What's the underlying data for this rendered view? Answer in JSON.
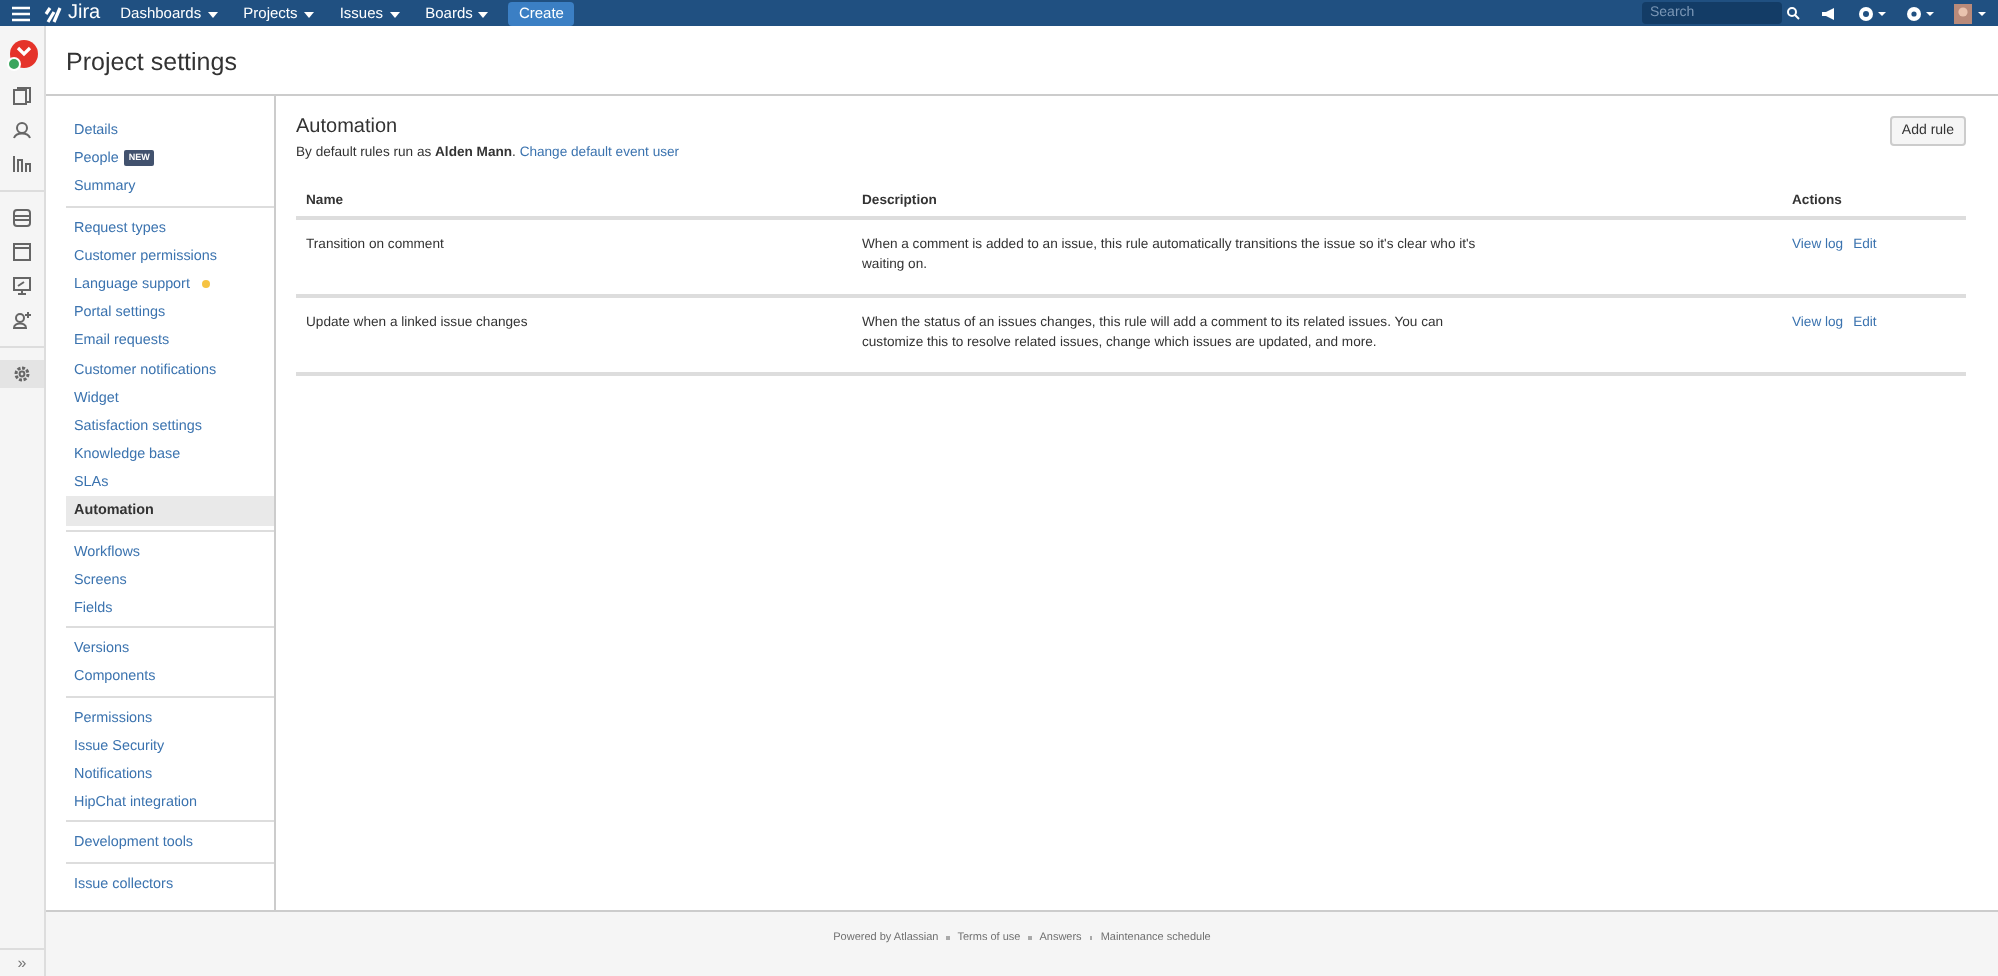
{
  "topbar": {
    "logo": "Jira",
    "menus": [
      {
        "label": "Dashboards"
      },
      {
        "label": "Projects"
      },
      {
        "label": "Issues"
      },
      {
        "label": "Boards"
      }
    ],
    "create": "Create",
    "search": {
      "placeholder": "Search"
    }
  },
  "rail": {
    "icons": [
      {
        "kind": "pages",
        "selected": false
      },
      {
        "kind": "team",
        "selected": false
      },
      {
        "kind": "chart",
        "selected": false
      },
      {
        "kind": "queue",
        "selected": false
      },
      {
        "kind": "window",
        "selected": false
      },
      {
        "kind": "screen",
        "selected": false
      },
      {
        "kind": "adduser",
        "selected": false
      },
      {
        "kind": "gear",
        "selected": true
      }
    ],
    "expand": "»"
  },
  "page_title": "Project settings",
  "sidebar": {
    "groups": [
      [
        {
          "label": "Details",
          "selected": false
        },
        {
          "label": "People",
          "badge": "NEW",
          "selected": false
        },
        {
          "label": "Summary",
          "selected": false
        }
      ],
      [
        {
          "label": "Request types",
          "selected": false
        },
        {
          "label": "Customer permissions",
          "selected": false
        },
        {
          "label": "Language support",
          "notice": true,
          "selected": false
        },
        {
          "label": "Portal settings",
          "selected": false
        },
        {
          "label": "Email requests",
          "selected": false
        },
        {
          "label": "Customer notifications",
          "selected": false
        },
        {
          "label": "Widget",
          "selected": false
        },
        {
          "label": "Satisfaction settings",
          "selected": false
        },
        {
          "label": "Knowledge base",
          "selected": false
        },
        {
          "label": "SLAs",
          "selected": false
        },
        {
          "label": "Automation",
          "selected": true
        }
      ],
      [
        {
          "label": "Workflows",
          "selected": false
        },
        {
          "label": "Screens",
          "selected": false
        },
        {
          "label": "Fields",
          "selected": false
        }
      ],
      [
        {
          "label": "Versions",
          "selected": false
        },
        {
          "label": "Components",
          "selected": false
        }
      ],
      [
        {
          "label": "Permissions",
          "selected": false
        },
        {
          "label": "Issue Security",
          "selected": false
        },
        {
          "label": "Notifications",
          "selected": false
        },
        {
          "label": "HipChat integration",
          "selected": false
        }
      ],
      [
        {
          "label": "Development tools",
          "selected": false
        }
      ],
      [
        {
          "label": "Issue collectors",
          "selected": false
        }
      ]
    ]
  },
  "main": {
    "title": "Automation",
    "intro": "By default rules run as **Alden Mann**.",
    "intro_link": "Change default event user",
    "add_button": "Add rule",
    "table": {
      "columns": [
        "Name",
        "Description",
        "Actions"
      ],
      "rows": [
        {
          "name": "Transition on comment",
          "description": "When a comment is added to an issue, this rule automatically transitions the issue so it's clear who it's waiting on.",
          "actions": [
            "View log",
            "Edit"
          ]
        },
        {
          "name": "Update when a linked issue changes",
          "description": "When the status of an issues changes, this rule will add a comment to its related issues. You can customize this to resolve related issues, change which issues are updated, and more.",
          "actions": [
            "View log",
            "Edit"
          ]
        }
      ]
    }
  },
  "footer": {
    "links": [
      "Powered by Atlassian",
      "Terms of use",
      "Answers",
      "Maintenance schedule"
    ]
  }
}
